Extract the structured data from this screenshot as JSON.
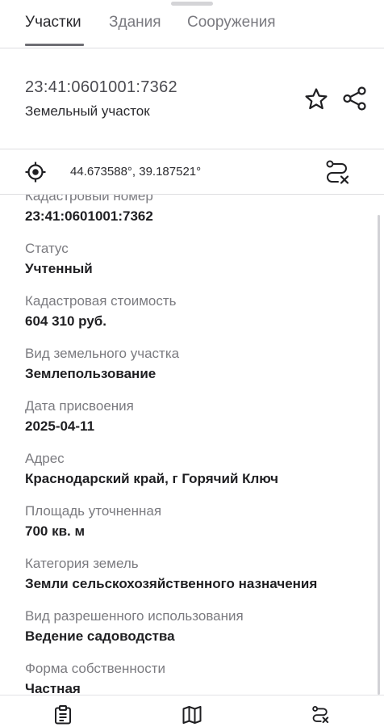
{
  "tabs": [
    {
      "label": "Участки",
      "active": true
    },
    {
      "label": "Здания",
      "active": false
    },
    {
      "label": "Сооружения",
      "active": false
    }
  ],
  "header": {
    "cadastral_number": "23:41:0601001:7362",
    "object_type": "Земельный участок"
  },
  "coords": {
    "value": "44.673588°, 39.187521°"
  },
  "fields": [
    {
      "label": "Кадастровый номер",
      "value": "23:41:0601001:7362"
    },
    {
      "label": "Статус",
      "value": "Учтенный"
    },
    {
      "label": "Кадастровая стоимость",
      "value": "604 310 руб."
    },
    {
      "label": "Вид земельного участка",
      "value": "Землепользование"
    },
    {
      "label": "Дата присвоения",
      "value": "2025-04-11"
    },
    {
      "label": "Адрес",
      "value": "Краснодарский край, г Горячий Ключ"
    },
    {
      "label": "Площадь уточненная",
      "value": "700 кв. м"
    },
    {
      "label": "Категория земель",
      "value": "Земли сельскохозяйственного назначения"
    },
    {
      "label": "Вид разрешенного использования",
      "value": "Ведение садоводства"
    },
    {
      "label": "Форма собственности",
      "value": "Частная"
    }
  ],
  "icons": {
    "favorite": "star-outline-icon",
    "share": "share-icon",
    "locate": "crosshair-icon",
    "route": "route-cancel-icon",
    "nav_info": "clipboard-icon",
    "nav_map": "map-icon",
    "nav_route": "route-cancel-icon"
  },
  "colors": {
    "text_primary": "#1f1f22",
    "text_secondary": "#7b7b80",
    "divider": "#dedee1",
    "icon": "#1f1f22"
  }
}
